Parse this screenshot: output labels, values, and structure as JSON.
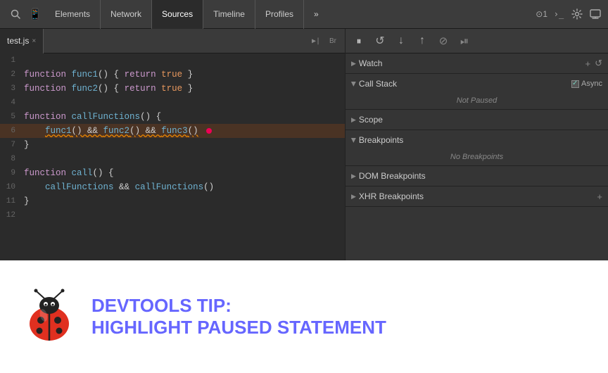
{
  "toolbar": {
    "tabs": [
      "Elements",
      "Network",
      "Sources",
      "Timeline",
      "Profiles"
    ],
    "active_tab": "Sources",
    "more_label": "»",
    "thread_label": "⊙1",
    "search_icon": "🔍",
    "mobile_icon": "📱",
    "terminal_icon": ">_",
    "settings_icon": "⚙",
    "screen_icon": "▭"
  },
  "file_tab": {
    "name": "test.js",
    "close": "×",
    "btn1": "▶|",
    "btn2": "Br"
  },
  "code": {
    "lines": [
      {
        "num": 1,
        "content": ""
      },
      {
        "num": 2,
        "content": "function func1() { return true }"
      },
      {
        "num": 3,
        "content": "function func2() { return true }"
      },
      {
        "num": 4,
        "content": ""
      },
      {
        "num": 5,
        "content": "function callFunctions() {"
      },
      {
        "num": 6,
        "content": "    func1() && func2() && func3()"
      },
      {
        "num": 7,
        "content": "}"
      },
      {
        "num": 8,
        "content": ""
      },
      {
        "num": 9,
        "content": "function call() {"
      },
      {
        "num": 10,
        "content": "    callFunctions && callFunctions()"
      },
      {
        "num": 11,
        "content": "}"
      },
      {
        "num": 12,
        "content": ""
      }
    ]
  },
  "debug_toolbar": {
    "pause_icon": "⏸",
    "record_icon": "↺",
    "step_over_icon": "↓",
    "step_in_icon": "↑",
    "deactivate_icon": "⊘",
    "pause2_icon": "⏯"
  },
  "right_panel": {
    "watch": {
      "label": "Watch",
      "add_icon": "+",
      "refresh_icon": "↺",
      "expanded": false
    },
    "call_stack": {
      "label": "Call Stack",
      "expanded": true,
      "async_label": "Async",
      "status": "Not Paused"
    },
    "scope": {
      "label": "Scope",
      "expanded": false
    },
    "breakpoints": {
      "label": "Breakpoints",
      "expanded": true,
      "status": "No Breakpoints"
    },
    "dom_breakpoints": {
      "label": "DOM Breakpoints",
      "expanded": false
    },
    "xhr_breakpoints": {
      "label": "XHR Breakpoints",
      "expanded": false,
      "add_icon": "+"
    }
  },
  "tip": {
    "title_line1": "DevTools Tip:",
    "title_line2": "Highlight Paused Statement"
  }
}
